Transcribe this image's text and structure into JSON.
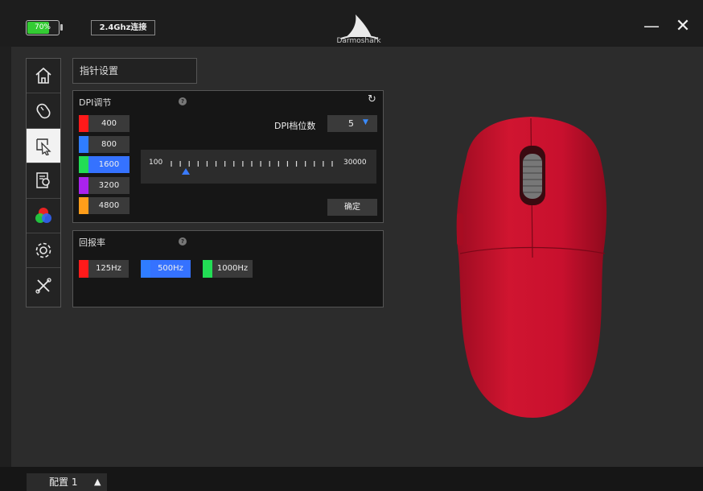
{
  "header": {
    "battery_text": "70%",
    "battery_level": 0.7,
    "connection_label": "2.4Ghz连接",
    "logo_text": "Darmoshark",
    "minimize_glyph": "—",
    "close_glyph": "✕"
  },
  "sidebar": {
    "items": [
      {
        "name": "home-icon",
        "active": false
      },
      {
        "name": "mouse-buttons-icon",
        "active": false
      },
      {
        "name": "pointer-settings-icon",
        "active": true
      },
      {
        "name": "macro-icon",
        "active": false
      },
      {
        "name": "rgb-lighting-icon",
        "active": false
      },
      {
        "name": "settings-gear-icon",
        "active": false
      },
      {
        "name": "tools-icon",
        "active": false
      }
    ]
  },
  "page_title": "指针设置",
  "dpi_panel": {
    "title": "DPI调节",
    "help_glyph": "?",
    "reset_glyph": "↻",
    "levels": [
      {
        "value": "400",
        "color": "#ff1a1a",
        "selected": false
      },
      {
        "value": "800",
        "color": "#2f7dff",
        "selected": false
      },
      {
        "value": "1600",
        "color": "#22dd55",
        "selected": true
      },
      {
        "value": "3200",
        "color": "#aa22ee",
        "selected": false
      },
      {
        "value": "4800",
        "color": "#ff9d1a",
        "selected": false
      }
    ],
    "level_count_label": "DPI档位数",
    "level_count_value": "5",
    "slider_min": "100",
    "slider_max": "30000",
    "slider_value": 1600,
    "confirm_label": "确定"
  },
  "report_panel": {
    "title": "回报率",
    "help_glyph": "?",
    "rates": [
      {
        "value": "125Hz",
        "color": "#ff1a1a",
        "selected": false
      },
      {
        "value": "500Hz",
        "color": "#2f7dff",
        "selected": true
      },
      {
        "value": "1000Hz",
        "color": "#22dd55",
        "selected": false
      }
    ]
  },
  "footer": {
    "profile_label": "配置 1",
    "profile_arrow": "▲"
  },
  "colors": {
    "accent": "#3572ff",
    "mouse_body": "#c8102e"
  }
}
